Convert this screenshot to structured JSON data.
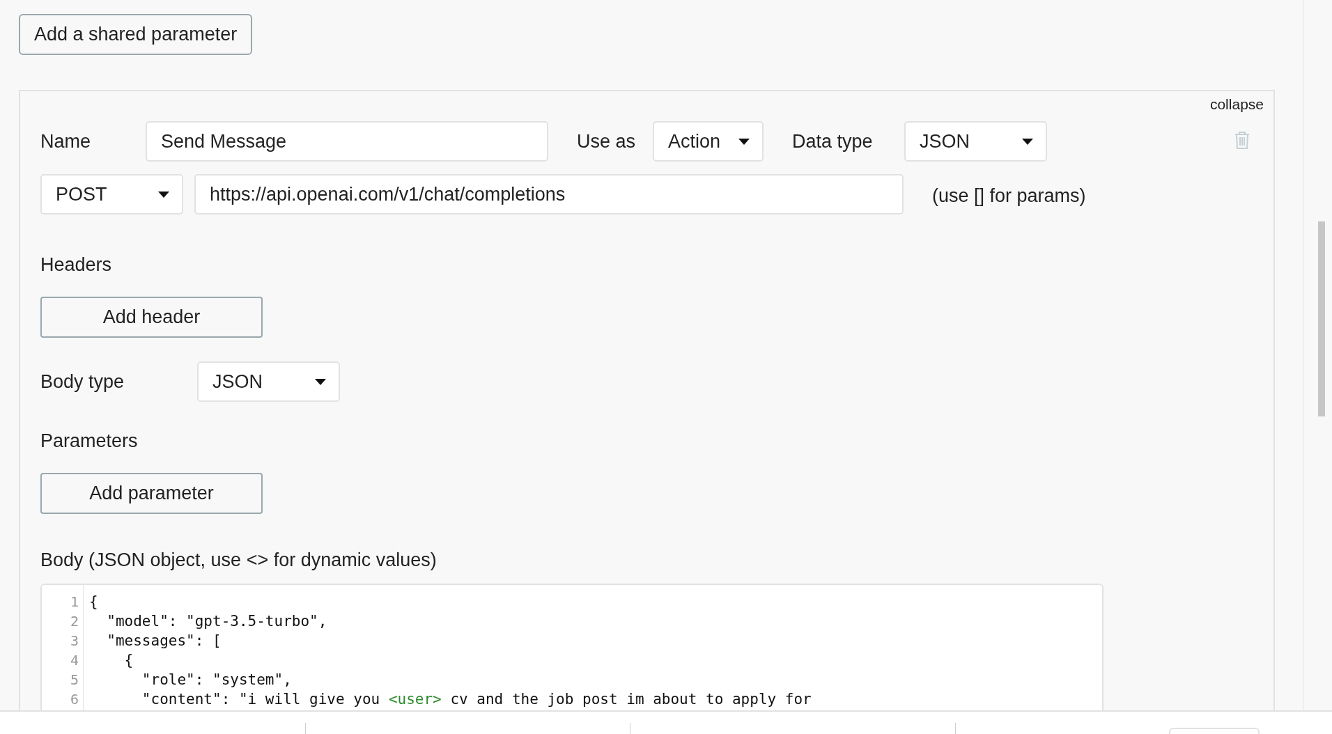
{
  "add_shared_parameter_button": "Add a shared parameter",
  "call": {
    "collapse_link": "collapse",
    "name_label": "Name",
    "name_value": "Send Message",
    "use_as_label": "Use as",
    "use_as_value": "Action",
    "data_type_label": "Data type",
    "data_type_value": "JSON",
    "method": "POST",
    "url": "https://api.openai.com/v1/chat/completions",
    "url_hint": "(use [] for params)",
    "headers_label": "Headers",
    "add_header_button": "Add header",
    "body_type_label": "Body type",
    "body_type_value": "JSON",
    "parameters_label": "Parameters",
    "add_parameter_button": "Add parameter",
    "body_label": "Body (JSON object, use <> for dynamic values)",
    "body_lines": [
      {
        "number": "1",
        "segments": [
          {
            "kind": "plain",
            "text": "{"
          }
        ]
      },
      {
        "number": "2",
        "segments": [
          {
            "kind": "plain",
            "text": "  \"model\": \"gpt-3.5-turbo\","
          }
        ]
      },
      {
        "number": "3",
        "segments": [
          {
            "kind": "plain",
            "text": "  \"messages\": ["
          }
        ]
      },
      {
        "number": "4",
        "segments": [
          {
            "kind": "plain",
            "text": "    {"
          }
        ]
      },
      {
        "number": "5",
        "segments": [
          {
            "kind": "plain",
            "text": "      \"role\": \"system\","
          }
        ]
      },
      {
        "number": "6",
        "segments": [
          {
            "kind": "plain",
            "text": "      \"content\": \"i will give you "
          },
          {
            "kind": "dynamic",
            "text": "<user>"
          },
          {
            "kind": "plain",
            "text": " cv and the job post im about to apply for"
          }
        ]
      }
    ]
  }
}
